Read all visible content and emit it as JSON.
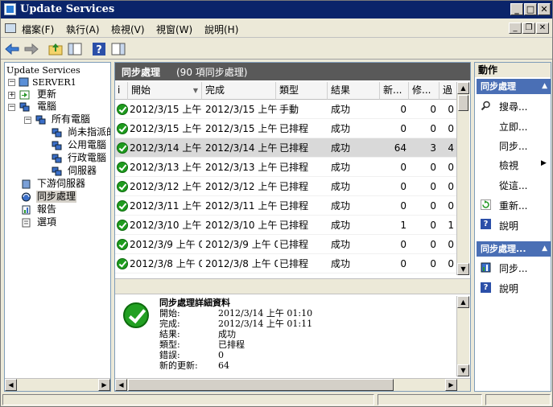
{
  "window": {
    "title": "Update Services"
  },
  "menu": {
    "items": [
      "檔案(F)",
      "執行(A)",
      "檢視(V)",
      "視窗(W)",
      "說明(H)"
    ]
  },
  "tree": {
    "items": [
      {
        "label": "Update Services",
        "name": "tree-update-services"
      },
      {
        "label": "SERVER1",
        "name": "tree-server1"
      },
      {
        "label": "更新",
        "name": "tree-updates"
      },
      {
        "label": "電腦",
        "name": "tree-computers"
      },
      {
        "label": "所有電腦",
        "name": "tree-all-computers"
      },
      {
        "label": "尚未指派的",
        "name": "tree-unassigned"
      },
      {
        "label": "公用電腦",
        "name": "tree-public-computers"
      },
      {
        "label": "行政電腦",
        "name": "tree-admin-computers"
      },
      {
        "label": "伺服器",
        "name": "tree-servers"
      },
      {
        "label": "下游伺服器",
        "name": "tree-downstream"
      },
      {
        "label": "同步處理",
        "name": "tree-synchronizations"
      },
      {
        "label": "報告",
        "name": "tree-reports"
      },
      {
        "label": "選項",
        "name": "tree-options"
      }
    ]
  },
  "center": {
    "title": "同步處理",
    "subtitle": "(90 項同步處理)",
    "columns": [
      "開始",
      "完成",
      "類型",
      "結果",
      "新...",
      "修...",
      "過"
    ],
    "rows": [
      {
        "start": "2012/3/15 上午 ...",
        "end": "2012/3/15 上午 ...",
        "type": "手動",
        "result": "成功",
        "new": "0",
        "rev": "0",
        "exp": "0"
      },
      {
        "start": "2012/3/15 上午 ...",
        "end": "2012/3/15 上午 ...",
        "type": "已排程",
        "result": "成功",
        "new": "0",
        "rev": "0",
        "exp": "0"
      },
      {
        "start": "2012/3/14 上午 ...",
        "end": "2012/3/14 上午 ...",
        "type": "已排程",
        "result": "成功",
        "new": "64",
        "rev": "3",
        "exp": "4"
      },
      {
        "start": "2012/3/13 上午 ...",
        "end": "2012/3/13 上午 ...",
        "type": "已排程",
        "result": "成功",
        "new": "0",
        "rev": "0",
        "exp": "0"
      },
      {
        "start": "2012/3/12 上午 ...",
        "end": "2012/3/12 上午 ...",
        "type": "已排程",
        "result": "成功",
        "new": "0",
        "rev": "0",
        "exp": "0"
      },
      {
        "start": "2012/3/11 上午 ...",
        "end": "2012/3/11 上午 ...",
        "type": "已排程",
        "result": "成功",
        "new": "0",
        "rev": "0",
        "exp": "0"
      },
      {
        "start": "2012/3/10 上午 ...",
        "end": "2012/3/10 上午 ...",
        "type": "已排程",
        "result": "成功",
        "new": "1",
        "rev": "0",
        "exp": "1"
      },
      {
        "start": "2012/3/9 上午 0...",
        "end": "2012/3/9 上午 0...",
        "type": "已排程",
        "result": "成功",
        "new": "0",
        "rev": "0",
        "exp": "0"
      },
      {
        "start": "2012/3/8 上午 0...",
        "end": "2012/3/8 上午 0...",
        "type": "已排程",
        "result": "成功",
        "new": "0",
        "rev": "0",
        "exp": "0"
      }
    ],
    "selected_row": 2
  },
  "details": {
    "title": "同步處理詳細資料",
    "fields": [
      {
        "label": "開始:",
        "value": "2012/3/14 上午 01:10"
      },
      {
        "label": "完成:",
        "value": "2012/3/14 上午 01:11"
      },
      {
        "label": "結果:",
        "value": "成功"
      },
      {
        "label": "類型:",
        "value": "已排程"
      },
      {
        "label": "錯誤:",
        "value": "0"
      },
      {
        "label": "新的更新:",
        "value": "64"
      }
    ]
  },
  "actions": {
    "header": "動作",
    "section1": "同步處理",
    "items1": [
      "搜尋...",
      "立即...",
      "同步...",
      "檢視",
      "從這...",
      "重新...",
      "說明"
    ],
    "section2": "同步處理...",
    "items2": [
      "同步...",
      "說明"
    ]
  }
}
